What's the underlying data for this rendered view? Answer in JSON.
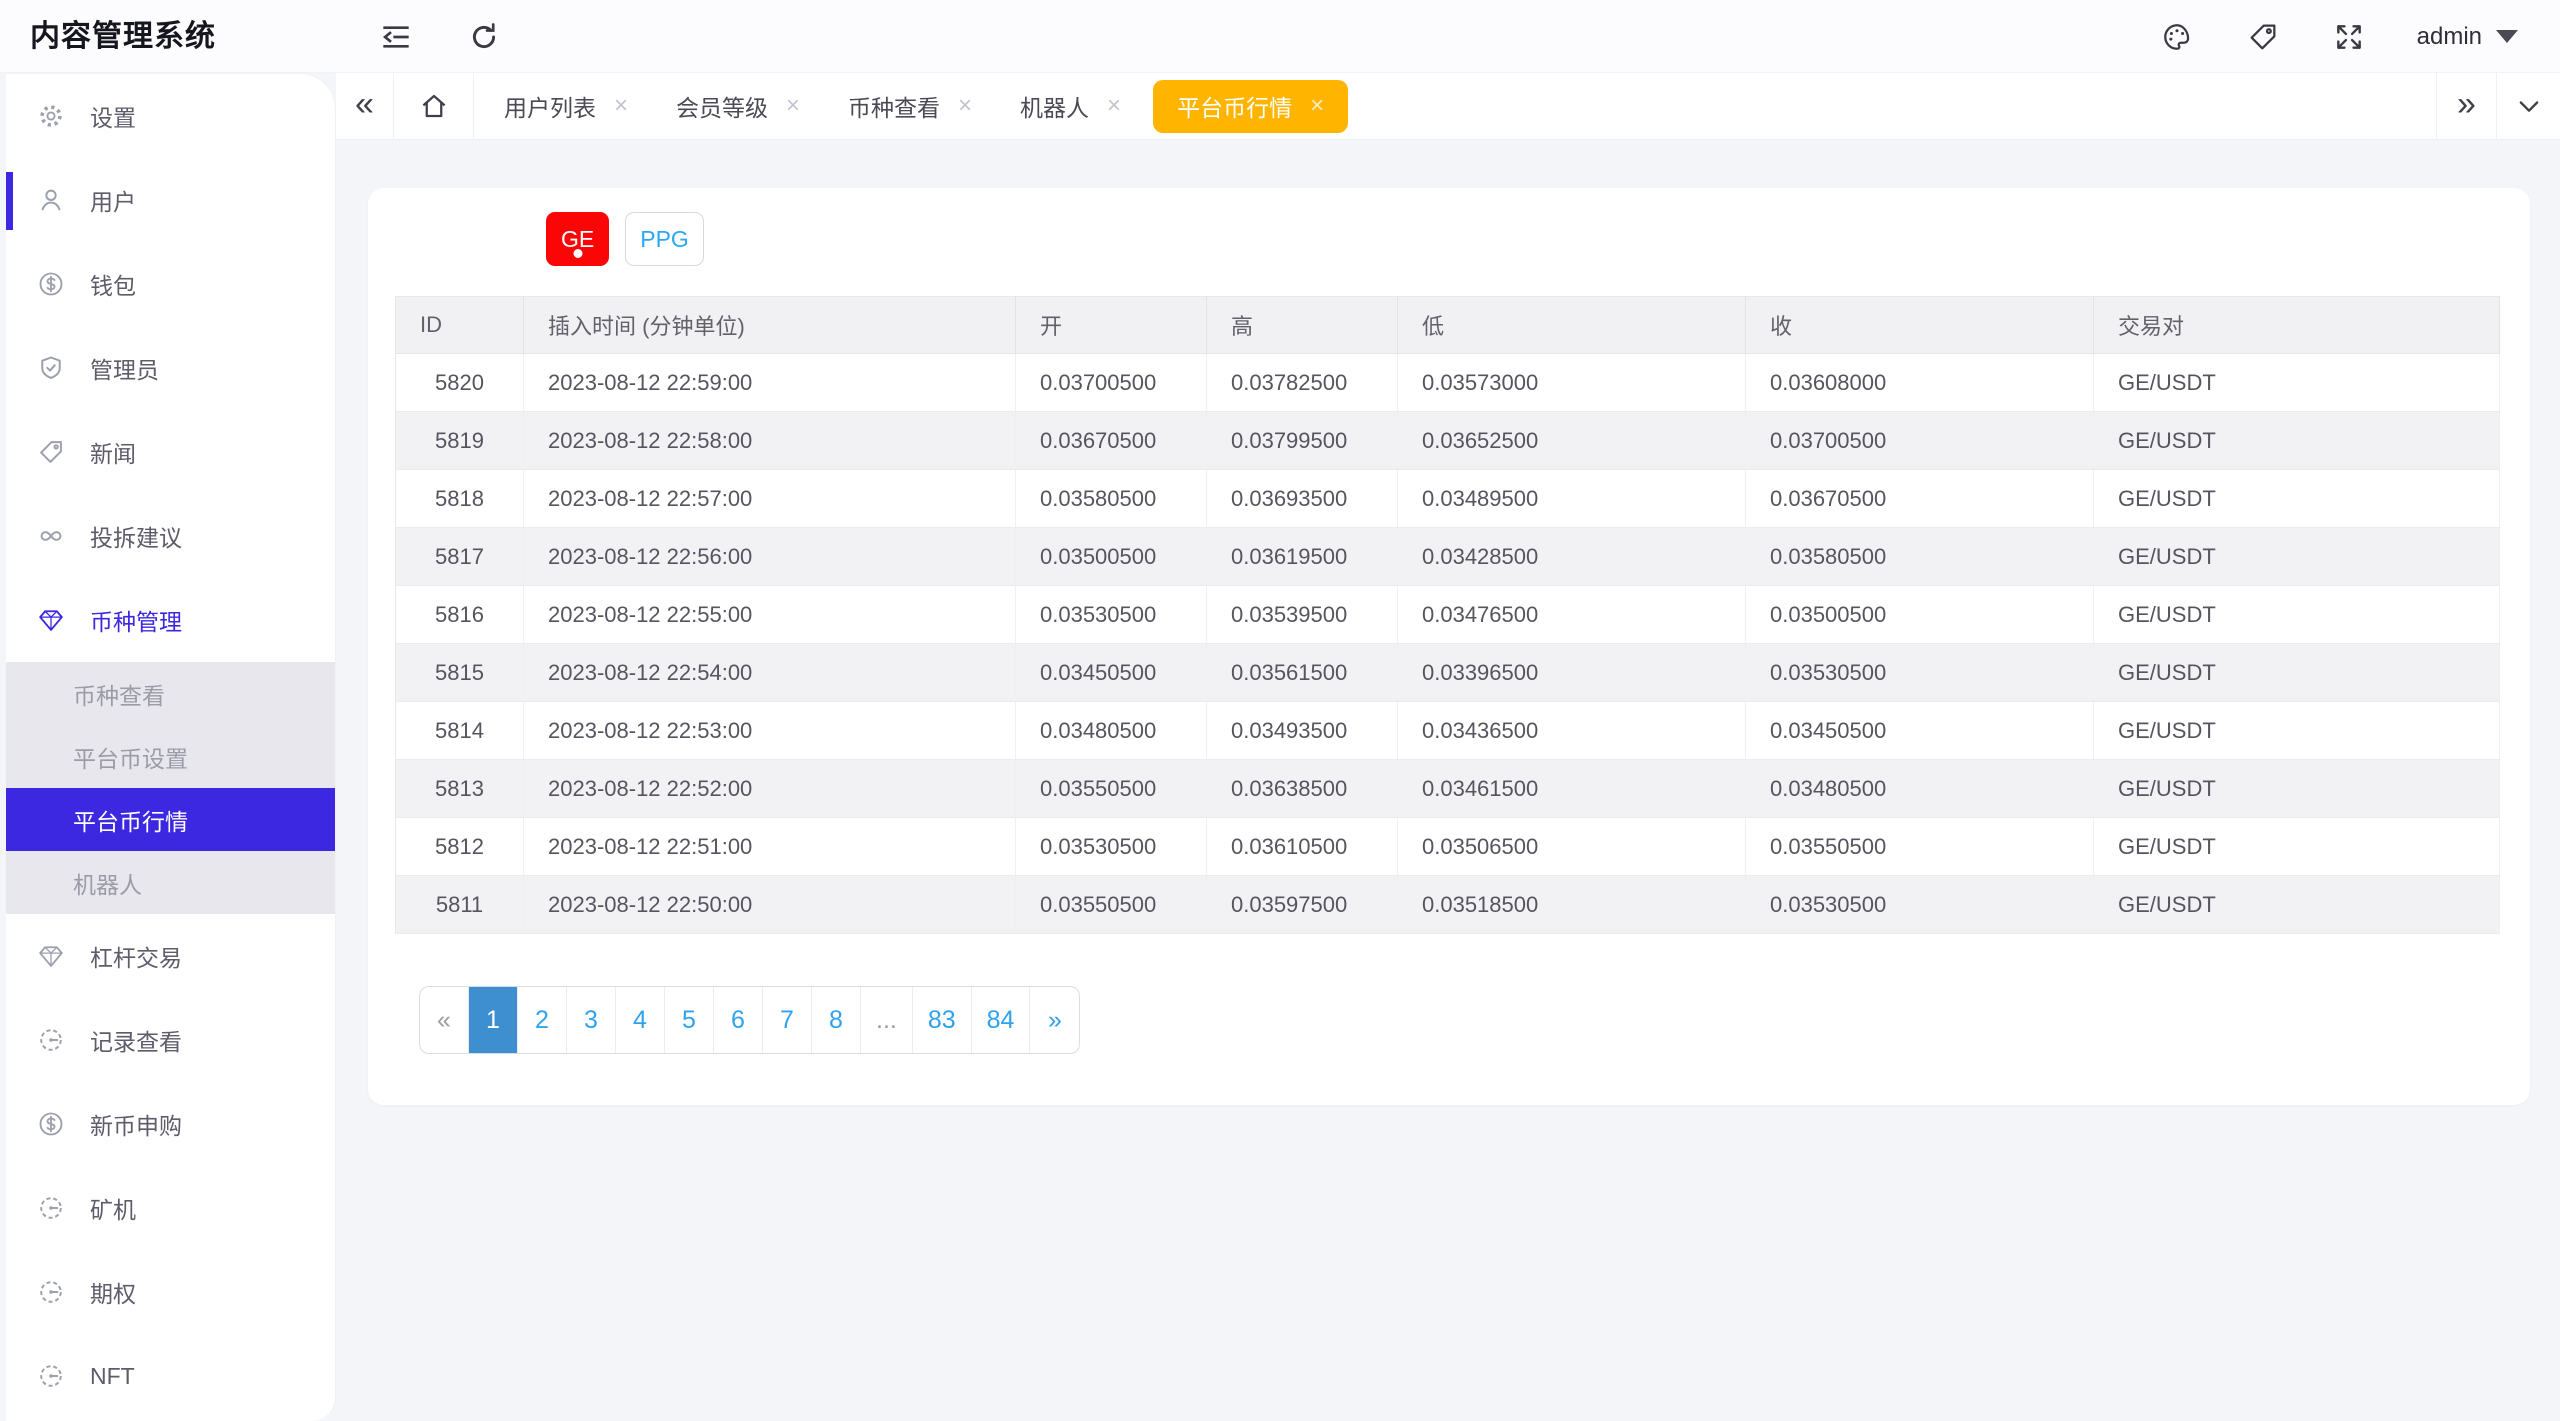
{
  "app": {
    "title": "内容管理系统"
  },
  "topbar": {
    "left_icons": [
      "menu-fold-icon",
      "refresh-icon"
    ],
    "right_icons": [
      "palette-icon",
      "tag-icon",
      "fullscreen-icon"
    ],
    "user": "admin"
  },
  "sidebar": {
    "items": [
      {
        "key": "settings",
        "label": "设置",
        "icon": "gear-icon"
      },
      {
        "key": "users",
        "label": "用户",
        "icon": "user-icon",
        "indicator": true
      },
      {
        "key": "wallet",
        "label": "钱包",
        "icon": "dollar-circle-icon"
      },
      {
        "key": "admins",
        "label": "管理员",
        "icon": "shield-check-icon"
      },
      {
        "key": "news",
        "label": "新闻",
        "icon": "tag-icon"
      },
      {
        "key": "feedback",
        "label": "投拆建议",
        "icon": "infinity-icon"
      },
      {
        "key": "coin-manage",
        "label": "币种管理",
        "icon": "gem-icon",
        "active": true,
        "children": [
          {
            "key": "coin-view",
            "label": "币种查看"
          },
          {
            "key": "platform-coin-settings",
            "label": "平台币设置"
          },
          {
            "key": "platform-coin-market",
            "label": "平台币行情",
            "active": true
          },
          {
            "key": "robot",
            "label": "机器人"
          }
        ]
      },
      {
        "key": "leverage-trade",
        "label": "杠杆交易",
        "icon": "gem-icon"
      },
      {
        "key": "records-view",
        "label": "记录查看",
        "icon": "gauge-icon"
      },
      {
        "key": "new-coin-subscribe",
        "label": "新币申购",
        "icon": "dollar-circle-icon"
      },
      {
        "key": "miner",
        "label": "矿机",
        "icon": "gauge-icon"
      },
      {
        "key": "options",
        "label": "期权",
        "icon": "gauge-icon"
      },
      {
        "key": "nft",
        "label": "NFT",
        "icon": "gauge-icon"
      }
    ]
  },
  "tabstrip": {
    "collapse": "«",
    "forward": "»",
    "tabs": [
      {
        "key": "user-list",
        "label": "用户列表"
      },
      {
        "key": "member-level",
        "label": "会员等级"
      },
      {
        "key": "coin-view",
        "label": "币种查看"
      },
      {
        "key": "robot",
        "label": "机器人"
      },
      {
        "key": "platform-coin-market",
        "label": "平台币行情",
        "active": true
      }
    ],
    "close_glyph": "×"
  },
  "main": {
    "coin_tabs": [
      {
        "key": "ge",
        "label": "GE",
        "active": true
      },
      {
        "key": "ppg",
        "label": "PPG"
      }
    ],
    "table": {
      "columns": [
        {
          "key": "id",
          "label": "ID"
        },
        {
          "key": "time",
          "label": "插入时间 (分钟单位)"
        },
        {
          "key": "open",
          "label": "开"
        },
        {
          "key": "high",
          "label": "高"
        },
        {
          "key": "low",
          "label": "低"
        },
        {
          "key": "close",
          "label": "收"
        },
        {
          "key": "pair",
          "label": "交易对"
        }
      ],
      "rows": [
        [
          "5820",
          "2023-08-12 22:59:00",
          "0.03700500",
          "0.03782500",
          "0.03573000",
          "0.03608000",
          "GE/USDT"
        ],
        [
          "5819",
          "2023-08-12 22:58:00",
          "0.03670500",
          "0.03799500",
          "0.03652500",
          "0.03700500",
          "GE/USDT"
        ],
        [
          "5818",
          "2023-08-12 22:57:00",
          "0.03580500",
          "0.03693500",
          "0.03489500",
          "0.03670500",
          "GE/USDT"
        ],
        [
          "5817",
          "2023-08-12 22:56:00",
          "0.03500500",
          "0.03619500",
          "0.03428500",
          "0.03580500",
          "GE/USDT"
        ],
        [
          "5816",
          "2023-08-12 22:55:00",
          "0.03530500",
          "0.03539500",
          "0.03476500",
          "0.03500500",
          "GE/USDT"
        ],
        [
          "5815",
          "2023-08-12 22:54:00",
          "0.03450500",
          "0.03561500",
          "0.03396500",
          "0.03530500",
          "GE/USDT"
        ],
        [
          "5814",
          "2023-08-12 22:53:00",
          "0.03480500",
          "0.03493500",
          "0.03436500",
          "0.03450500",
          "GE/USDT"
        ],
        [
          "5813",
          "2023-08-12 22:52:00",
          "0.03550500",
          "0.03638500",
          "0.03461500",
          "0.03480500",
          "GE/USDT"
        ],
        [
          "5812",
          "2023-08-12 22:51:00",
          "0.03530500",
          "0.03610500",
          "0.03506500",
          "0.03550500",
          "GE/USDT"
        ],
        [
          "5811",
          "2023-08-12 22:50:00",
          "0.03550500",
          "0.03597500",
          "0.03518500",
          "0.03530500",
          "GE/USDT"
        ]
      ]
    },
    "pagination": {
      "items": [
        {
          "key": "prev",
          "label": "«",
          "muted": true
        },
        {
          "key": "page-1",
          "label": "1",
          "active": true
        },
        {
          "key": "page-2",
          "label": "2"
        },
        {
          "key": "page-3",
          "label": "3"
        },
        {
          "key": "page-4",
          "label": "4"
        },
        {
          "key": "page-5",
          "label": "5"
        },
        {
          "key": "page-6",
          "label": "6"
        },
        {
          "key": "page-7",
          "label": "7"
        },
        {
          "key": "page-8",
          "label": "8"
        },
        {
          "key": "ellipsis",
          "label": "...",
          "muted": true,
          "static": true
        },
        {
          "key": "page-83",
          "label": "83"
        },
        {
          "key": "page-84",
          "label": "84"
        },
        {
          "key": "next",
          "label": "»"
        }
      ]
    }
  },
  "colors": {
    "primary_purple": "#3C28E0",
    "tab_active_orange": "#FFB400",
    "coin_active_red": "#FA0606",
    "link_blue": "#29A9F2",
    "pagination_active_blue": "#3D8FD0",
    "page_background": "#F4F5F9"
  }
}
